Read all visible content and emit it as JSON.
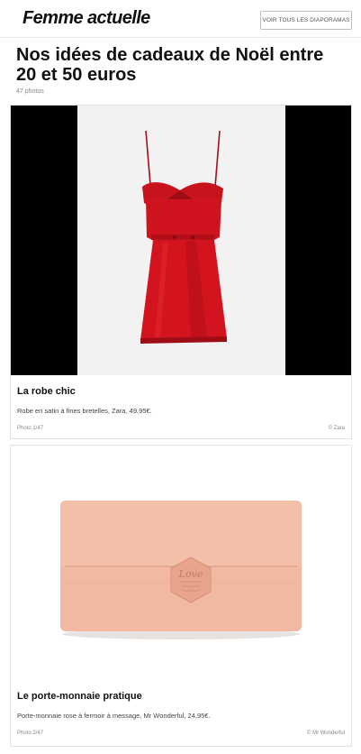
{
  "header": {
    "logo": "Femme actuelle",
    "all_slideshows_button": "VOIR TOUS LES DIAPORAMAS"
  },
  "article": {
    "title": "Nos idées de cadeaux de Noël entre 20 et 50 euros",
    "photo_count": "47 photos"
  },
  "slides": [
    {
      "title": "La robe chic",
      "description": "Robe en satin à fines bretelles, Zara, 49,95€.",
      "counter": "Photo 1/47",
      "credit": "© Zara",
      "image_colors": {
        "dress": "#d0141f",
        "backdrop": "#f2f2f2",
        "side_bars": "#000000"
      }
    },
    {
      "title": "Le porte-monnaie pratique",
      "description": "Porte-monnaie rose à fermoir à message, Mr Wonderful, 24,95€.",
      "counter": "Photo 2/47",
      "credit": "© Mr Wonderful",
      "image_colors": {
        "wallet": "#f1b9a2",
        "backdrop": "#ffffff"
      }
    }
  ]
}
